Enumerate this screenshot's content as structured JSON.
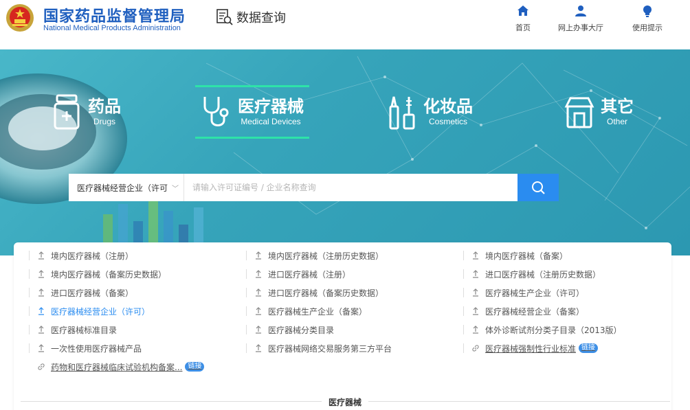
{
  "header": {
    "brand_cn": "国家药品监督管理局",
    "brand_en": "National Medical Products Administration",
    "section": "数据查询",
    "nav": [
      {
        "label": "首页",
        "icon": "home-icon"
      },
      {
        "label": "网上办事大厅",
        "icon": "user-icon"
      },
      {
        "label": "使用提示",
        "icon": "bulb-icon"
      }
    ]
  },
  "categories": [
    {
      "cn": "药品",
      "en": "Drugs",
      "icon": "drug-bottle-icon"
    },
    {
      "cn": "医疗器械",
      "en": "Medical Devices",
      "icon": "stethoscope-icon",
      "active": true
    },
    {
      "cn": "化妆品",
      "en": "Cosmetics",
      "icon": "cosmetics-icon"
    },
    {
      "cn": "其它",
      "en": "Other",
      "icon": "shop-icon"
    }
  ],
  "search": {
    "selected": "医疗器械经营企业（许可",
    "placeholder": "请输入许可证编号 / 企业名称查询"
  },
  "list": [
    [
      "境内医疗器械（注册）",
      "境内医疗器械（注册历史数据）",
      "境内医疗器械（备案）"
    ],
    [
      "境内医疗器械（备案历史数据）",
      "进口医疗器械（注册）",
      "进口医疗器械（注册历史数据）"
    ],
    [
      "进口医疗器械（备案）",
      "进口医疗器械（备案历史数据）",
      "医疗器械生产企业（许可）"
    ],
    [
      "医疗器械经营企业（许可）",
      "医疗器械生产企业（备案）",
      "医疗器械经营企业（备案）"
    ],
    [
      "医疗器械标准目录",
      "医疗器械分类目录",
      "体外诊断试剂分类子目录（2013版）"
    ],
    [
      "一次性使用医疗器械产品",
      "医疗器械网络交易服务第三方平台",
      "医疗器械强制性行业标准"
    ],
    [
      "药物和医疗器械临床试验机构备案..."
    ]
  ],
  "badge_label": "链接",
  "section_title": "医疗器械",
  "colors": {
    "accent": "#2a8cf0",
    "brand": "#1f5fbf",
    "banner": "#36a4ba",
    "highlight": "#2ee3a8"
  }
}
